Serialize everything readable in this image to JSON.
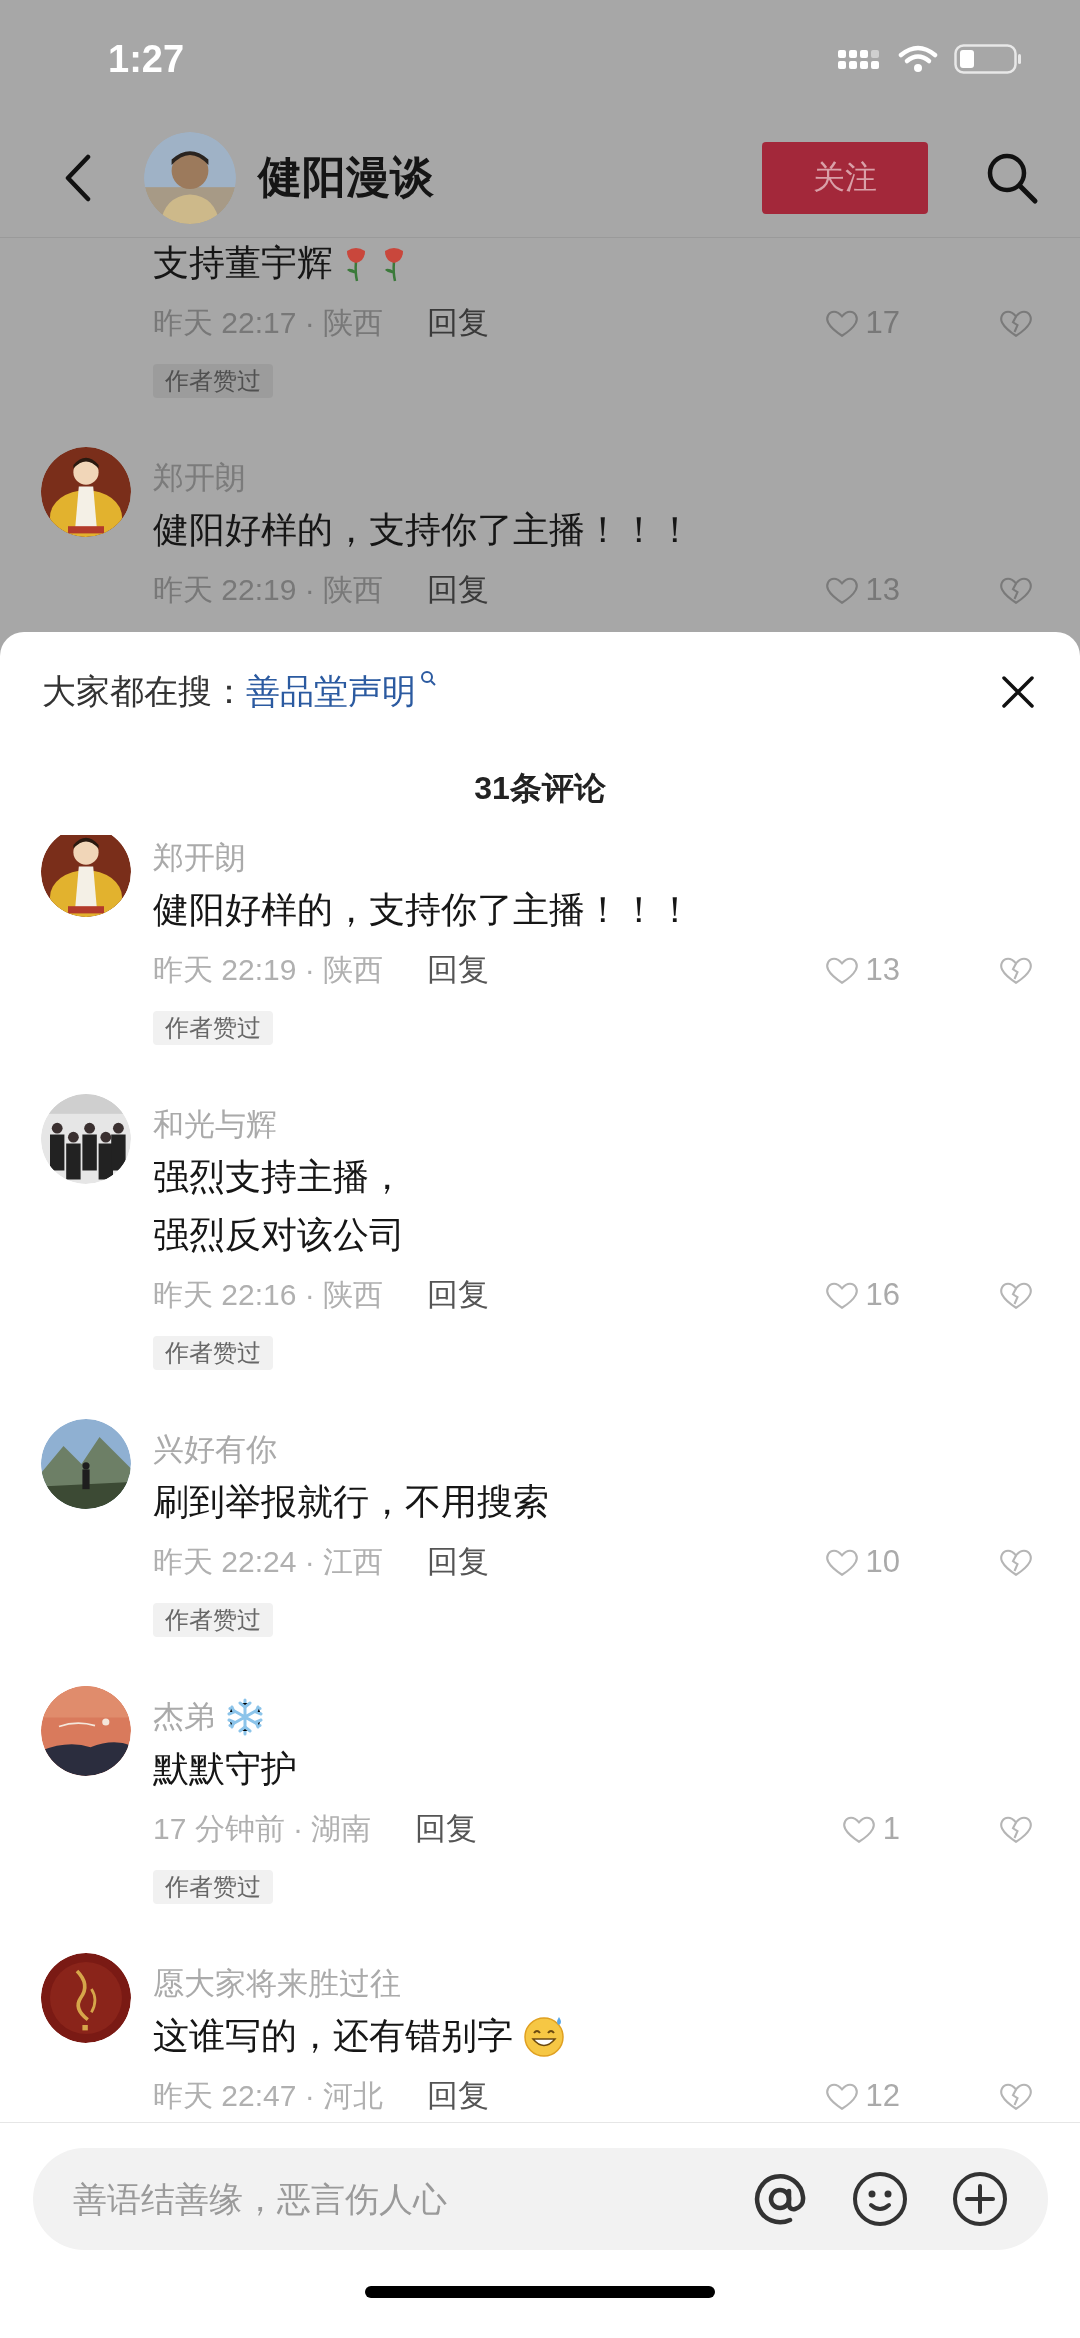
{
  "status_bar": {
    "time": "1:27"
  },
  "header": {
    "title": "健阳漫谈",
    "follow_button": "关注"
  },
  "background_comments": [
    {
      "text": "支持董宇辉",
      "trailing_icons": [
        {
          "kind": "rose"
        },
        {
          "kind": "rose"
        }
      ],
      "time_location": "昨天 22:17 · 陕西",
      "reply": "回复",
      "likes": "17",
      "tag": "作者赞过"
    },
    {
      "name": "郑开朗",
      "text": "健阳好样的，支持你了主播！！！",
      "time_location": "昨天 22:19 · 陕西",
      "reply": "回复",
      "likes": "13"
    }
  ],
  "comment_sheet": {
    "trending_label": "大家都在搜：",
    "trending_link": "善品堂声明",
    "comment_count": "31条评论",
    "comments": [
      {
        "name": "郑开朗",
        "text": "健阳好样的，支持你了主播！！！",
        "time_location": "昨天 22:19 · 陕西",
        "reply": "回复",
        "likes": "13",
        "tag": "作者赞过"
      },
      {
        "name": "和光与辉",
        "lines": [
          "强烈支持主播，",
          "强烈反对该公司"
        ],
        "time_location": "昨天 22:16 · 陕西",
        "reply": "回复",
        "likes": "16",
        "tag": "作者赞过"
      },
      {
        "name": "兴好有你",
        "text": "刷到举报就行，不用搜索",
        "time_location": "昨天 22:24 · 江西",
        "reply": "回复",
        "likes": "10",
        "tag": "作者赞过"
      },
      {
        "name": "杰弟",
        "name_icon": {
          "kind": "snowflake"
        },
        "text": "默默守护",
        "time_location": "17 分钟前 · 湖南",
        "reply": "回复",
        "likes": "1",
        "tag": "作者赞过"
      },
      {
        "name": "愿大家将来胜过往",
        "text": "这谁写的，还有错别字",
        "trailing_icons": [
          {
            "kind": "grin"
          }
        ],
        "time_location": "昨天 22:47 · 河北",
        "reply": "回复",
        "likes": "12"
      }
    ],
    "input": {
      "placeholder": "善语结善缘，恶言伤人心"
    }
  }
}
